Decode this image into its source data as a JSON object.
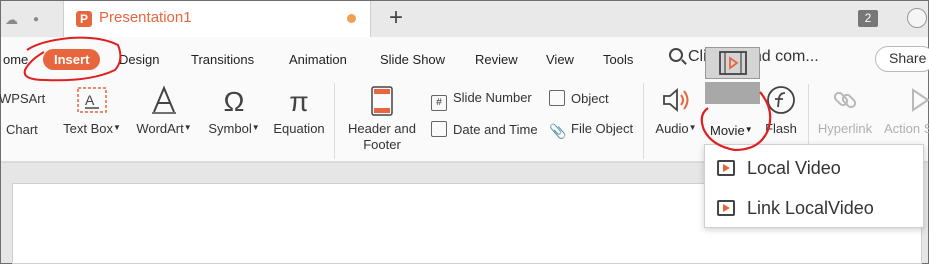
{
  "tabbar": {
    "doc_title": "Presentation1",
    "doc_logo": "P",
    "new_tab_label": "+",
    "window_count": "2"
  },
  "menu": {
    "tabs": [
      "ome",
      "Insert",
      "Design",
      "Transitions",
      "Animation",
      "Slide Show",
      "Review",
      "View",
      "Tools"
    ],
    "search_placeholder": "Click to find com...",
    "share_label": "Share"
  },
  "ribbon": {
    "wpsart_label": "WPSArt",
    "chart_label": "Chart",
    "textbox_label": "Text Box",
    "wordart_label": "WordArt",
    "symbol_label": "Symbol",
    "equation_label": "Equation",
    "header_footer_label_1": "Header and",
    "header_footer_label_2": "Footer",
    "slide_number_label": "Slide Number",
    "object_label": "Object",
    "date_time_label": "Date and Time",
    "file_object_label": "File Object",
    "audio_label": "Audio",
    "movie_label": "Movie",
    "flash_label": "Flash",
    "hyperlink_label": "Hyperlink",
    "action_label": "Action S",
    "icons": {
      "textbox": "text-box-icon",
      "wordart": "wordart-icon",
      "symbol": "Ω",
      "equation": "π"
    }
  },
  "dropdown": {
    "items": [
      "Local Video",
      "Link LocalVideo"
    ]
  },
  "colors": {
    "accent": "#e8663d",
    "annotation": "#e02020"
  }
}
